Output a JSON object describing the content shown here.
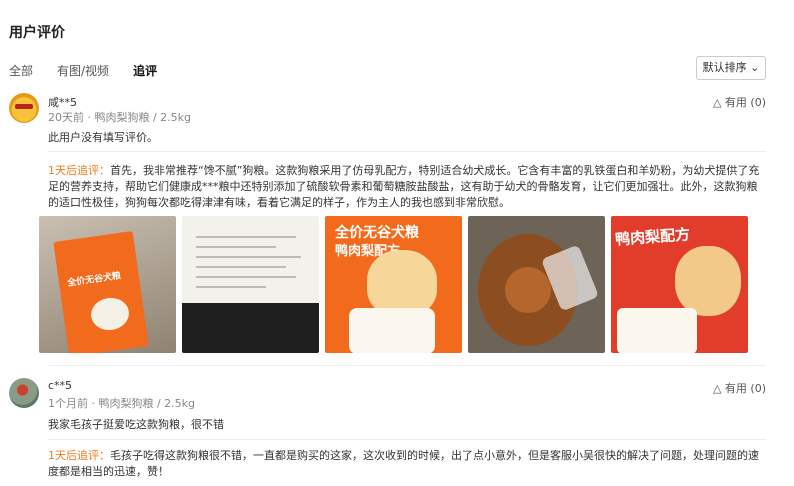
{
  "title": "用户评价",
  "tabs": [
    {
      "label": "全部",
      "active": false
    },
    {
      "label": "有图/视频",
      "active": false
    },
    {
      "label": "追评",
      "active": true
    }
  ],
  "sort": {
    "label": "默认排序"
  },
  "reviews": [
    {
      "user": "咸**5",
      "meta": "20天前 · 鸭肉梨狗粮 / 2.5kg",
      "useful": "有用 (0)",
      "content": "此用户没有填写评价。",
      "followup_label": "1天后追评：",
      "followup_text": "首先，我非常推荐“馋不腻”狗粮。这款狗粮采用了仿母乳配方，特别适合幼犬成长。它含有丰富的乳铁蛋白和羊奶粉，为幼犬提供了充足的营养支持，帮助它们健康成***粮中还特别添加了硫酸软骨素和葡萄糖胺盐酸盐，这有助于幼犬的骨骼发育，让它们更加强壮。此外，这款狗粮的适口性极佳，狗狗每次都吃得津津有味，看着它满足的样子，作为主人的我也感到非常欣慰。",
      "images": [
        "product-photo-1",
        "product-photo-2",
        "product-photo-3",
        "product-photo-4",
        "product-photo-5"
      ],
      "bag_texts": [
        "全价无谷犬粮",
        "鸭肉梨配方",
        "全价无谷犬粮",
        "鸭肉梨配方"
      ]
    },
    {
      "user": "c**5",
      "meta": "1个月前 · 鸭肉梨狗粮 / 2.5kg",
      "useful": "有用 (0)",
      "content": "我家毛孩子挺爱吃这款狗粮，很不错",
      "followup_label": "1天后追评：",
      "followup_text": "毛孩子吃得这款狗粮很不错，一直都是购买的这家，这次收到的时候，出了点小意外，但是客服小吴很快的解决了问题，处理问题的速度都是相当的迅速，赞！"
    }
  ]
}
